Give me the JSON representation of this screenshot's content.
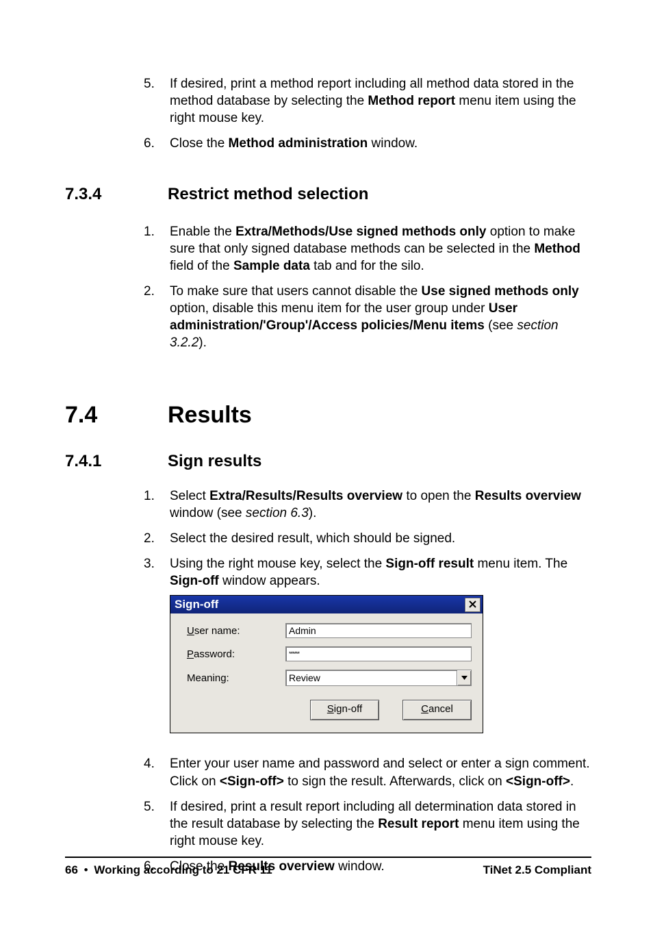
{
  "sec73_list": {
    "i5": {
      "num": "5.",
      "pre": "If desired, print a method report including all method data stored in the method database by selecting the ",
      "b1": "Method report",
      "post": " menu item using the right mouse key."
    },
    "i6": {
      "num": "6.",
      "pre": "Close the ",
      "b1": "Method administration",
      "post": " window."
    }
  },
  "h734": {
    "num": "7.3.4",
    "title": "Restrict method selection"
  },
  "sec734_list": {
    "i1": {
      "num": "1.",
      "pre": "Enable the ",
      "b1": "Extra/Methods/Use signed methods only",
      "mid1": " option to make sure that only signed database methods can be selected in the ",
      "b2": "Method",
      "mid2": " field of the ",
      "b3": "Sample data",
      "post": " tab and for the silo."
    },
    "i2": {
      "num": "2.",
      "pre": "To make sure that users cannot disable the ",
      "b1": "Use signed methods only",
      "mid1": " option, disable this menu item for the user group under ",
      "b2": "User administration/'Group'/Access policies/Menu items",
      "mid2": " (see ",
      "it": "section 3.2.2",
      "post": ")."
    }
  },
  "h74": {
    "num": "7.4",
    "title": "Results"
  },
  "h741": {
    "num": "7.4.1",
    "title": "Sign results"
  },
  "sec741_list": {
    "i1": {
      "num": "1.",
      "pre": "Select ",
      "b1": "Extra/Results/Results overview",
      "mid1": " to open the ",
      "b2": "Results overview",
      "mid2": " window (see ",
      "it": "section 6.3",
      "post": ")."
    },
    "i2": {
      "num": "2.",
      "text": "Select the desired result, which should be signed."
    },
    "i3": {
      "num": "3.",
      "pre": "Using the right mouse key, select the ",
      "b1": "Sign-off result",
      "mid1": " menu item. The ",
      "b2": "Sign-off",
      "post": " window appears."
    },
    "i4": {
      "num": "4.",
      "pre": "Enter your user name and password and select or enter a sign comment. Click on ",
      "b1": "<Sign-off>",
      "mid1": " to sign the result. Afterwards, click on ",
      "b2": "<Sign-off>",
      "post": "."
    },
    "i5": {
      "num": "5.",
      "pre": "If desired, print a result report including all determination data stored in the result database by selecting the ",
      "b1": "Result report",
      "post": " menu item using the right mouse key."
    },
    "i6": {
      "num": "6.",
      "pre": "Close the ",
      "b1": "Results overview",
      "post": " window."
    }
  },
  "dialog": {
    "title": "Sign-off",
    "labels": {
      "user_u": "U",
      "user_rest": "ser name:",
      "pass_u": "P",
      "pass_rest": "assword:",
      "meaning": "Meaning:"
    },
    "values": {
      "user": "Admin",
      "password": "******",
      "meaning": "Review"
    },
    "buttons": {
      "signoff_u": "S",
      "signoff_rest": "ign-off",
      "cancel_u": "C",
      "cancel_rest": "ancel"
    }
  },
  "footer": {
    "page": "66",
    "section": "Working according to 21 CFR 11",
    "product": "TiNet 2.5 Compliant"
  }
}
